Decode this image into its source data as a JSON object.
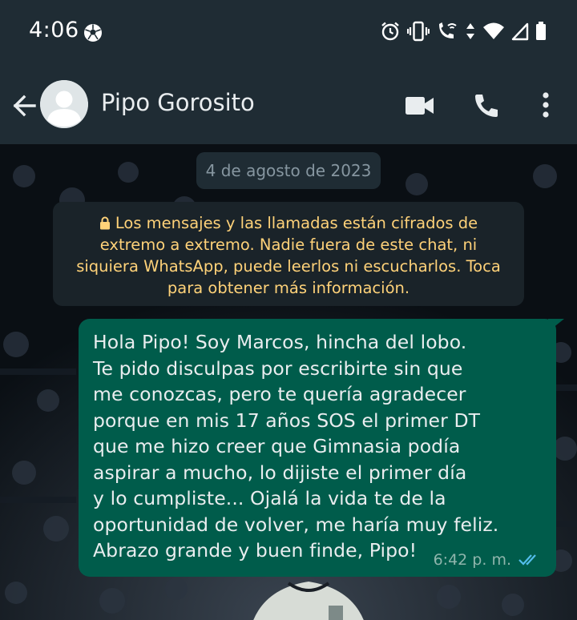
{
  "status_bar": {
    "time": "4:06",
    "icons": [
      "soccer-ball-icon",
      "alarm-icon",
      "vibrate-icon",
      "wifi-calling-icon",
      "data-arrows-icon",
      "wifi-icon",
      "cell-signal-icon",
      "battery-icon"
    ]
  },
  "header": {
    "contact_name": "Pipo Gorosito",
    "icons": [
      "back-arrow-icon",
      "avatar-icon",
      "video-call-icon",
      "phone-call-icon",
      "more-vert-icon"
    ]
  },
  "chat": {
    "date_chip": "4 de agosto de 2023",
    "encryption_notice": "Los mensajes y las llamadas están cifrados de extremo a extremo. Nadie fuera de este chat, ni siquiera WhatsApp, puede leerlos ni escucharlos. Toca para obtener más información.",
    "messages": [
      {
        "direction": "outgoing",
        "lines": [
          "Hola Pipo! Soy Marcos, hincha del lobo.",
          "Te pido disculpas por escribirte sin que",
          "me conozcas, pero te quería agradecer",
          "porque en mis 17 años SOS el primer DT",
          "que me hizo creer que Gimnasia podía",
          "aspirar a mucho, lo dijiste el primer día",
          "y lo cumpliste... Ojalá la vida te de la",
          "oportunidad de volver, me haría muy feliz.",
          "Abrazo grande y buen finde, Pipo!"
        ],
        "time": "6:42 p. m.",
        "status_icon": "double-check-read-icon"
      }
    ]
  },
  "colors": {
    "app_bar": "#1f2c34",
    "outgoing_bubble": "#005c4b",
    "encryption_text": "#ffd279",
    "read_ticks": "#53bdeb"
  }
}
